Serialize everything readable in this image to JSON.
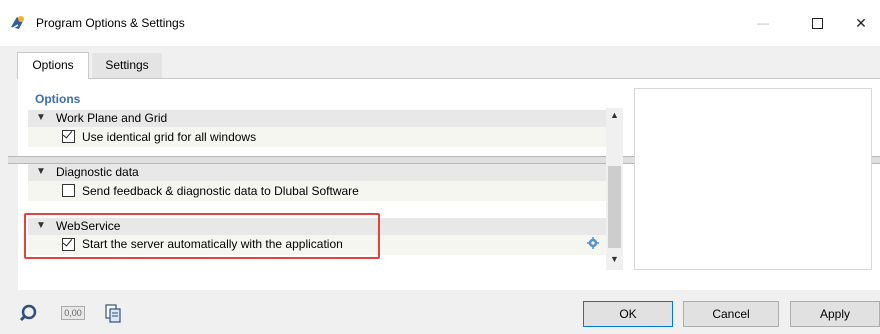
{
  "window": {
    "title": "Program Options & Settings",
    "controls": [
      "minimize",
      "maximize",
      "close"
    ],
    "minimize_glyph": "—",
    "close_glyph": "✕"
  },
  "tabs": [
    {
      "label": "Options",
      "active": true
    },
    {
      "label": "Settings",
      "active": false
    }
  ],
  "options": {
    "header": "Options",
    "groups": [
      {
        "title": "Work Plane and Grid",
        "expanded": true,
        "items": [
          {
            "label": "Use identical grid for all windows",
            "checked": true
          }
        ]
      },
      {
        "title": "Diagnostic data",
        "expanded": true,
        "items": [
          {
            "label": "Send feedback & diagnostic data to Dlubal Software",
            "checked": false
          }
        ]
      },
      {
        "title": "WebService",
        "expanded": true,
        "highlighted": true,
        "items": [
          {
            "label": "Start the server automatically with the application",
            "checked": true
          }
        ]
      }
    ]
  },
  "toolbar": {
    "tools": [
      "help-icon",
      "decimal-places-icon",
      "copy-settings-icon"
    ],
    "decimal_label": "0,00"
  },
  "buttons": {
    "ok": "OK",
    "cancel": "Cancel",
    "apply": "Apply"
  },
  "colors": {
    "highlight": "#e0443e",
    "section_label": "#3c6eb4",
    "ok_border": "#0078d7"
  }
}
